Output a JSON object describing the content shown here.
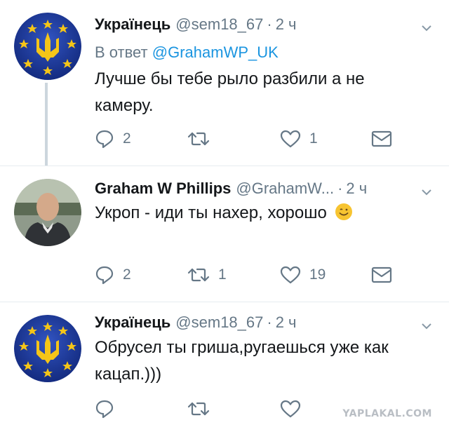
{
  "colors": {
    "text": "#14171a",
    "muted": "#657786",
    "link": "#1b95e0",
    "divider": "#e6ecf0",
    "thread": "#ccd6dd"
  },
  "tweets": [
    {
      "name": "Українець",
      "handle": "@sem18_67",
      "separator": "·",
      "time": "2 ч",
      "reply_prefix": "В ответ",
      "reply_handle": "@GrahamWP_UK",
      "text": "Лучше бы тебе рыло разбили а не камеру.",
      "replies": "2",
      "retweets": "",
      "likes": "1",
      "avatar_icon": "ukraine-trident-eu-stars"
    },
    {
      "name": "Graham W Phillips",
      "handle": "@GrahamW...",
      "separator": "·",
      "time": "2 ч",
      "text": "Укроп - иди ты нахер, хорошо",
      "emoji_icon": "smiling-face-emoji",
      "replies": "2",
      "retweets": "1",
      "likes": "19",
      "avatar_icon": "man-portrait-photo"
    },
    {
      "name": "Українець",
      "handle": "@sem18_67",
      "separator": "·",
      "time": "2 ч",
      "text": "Обрусел ты гриша,ругаешься уже как кацап.)))",
      "replies": "",
      "retweets": "",
      "likes": "",
      "avatar_icon": "ukraine-trident-eu-stars"
    }
  ],
  "watermark": "YAPLAKAL.COM"
}
